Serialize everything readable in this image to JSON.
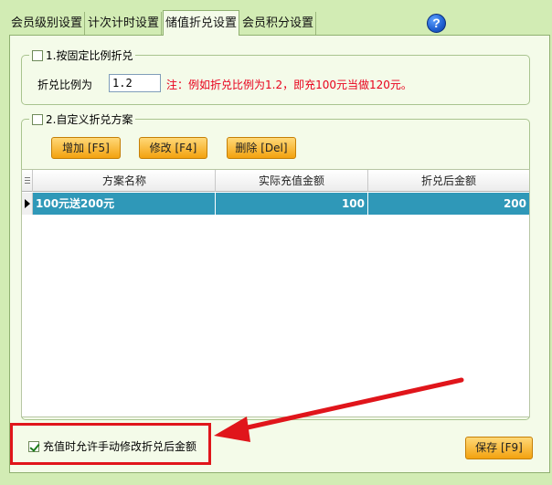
{
  "tabs": [
    {
      "label": "会员级别设置",
      "active": false
    },
    {
      "label": "计次计时设置",
      "active": false
    },
    {
      "label": "储值折兑设置",
      "active": true
    },
    {
      "label": "会员积分设置",
      "active": false
    }
  ],
  "help_icon": "help-question-icon",
  "fixed_ratio": {
    "title": "1.按固定比例折兑",
    "checked": false,
    "ratio_label": "折兑比例为",
    "ratio_value": "1.2",
    "note": "注：例如折兑比例为1.2，即充100元当做120元。"
  },
  "custom_plan": {
    "title": "2.自定义折兑方案",
    "checked": false,
    "buttons": {
      "add": "增加 [F5]",
      "edit": "修改 [F4]",
      "delete": "删除 [Del]"
    },
    "columns": [
      "方案名称",
      "实际充值金额",
      "折兑后金额"
    ],
    "rows": [
      {
        "name": "100元送200元",
        "actual": "100",
        "after": "200"
      }
    ]
  },
  "allow_manual": {
    "label": "充值时允许手动修改折兑后金额",
    "checked": true
  },
  "save_button": "保存 [F9]",
  "colors": {
    "background": "#d2ecb4",
    "panel": "#f4fbe9",
    "selected_row": "#2f98b8",
    "note_red": "#e8001c",
    "button_orange": "#f3a20f",
    "annotation_red": "#e0151b"
  }
}
